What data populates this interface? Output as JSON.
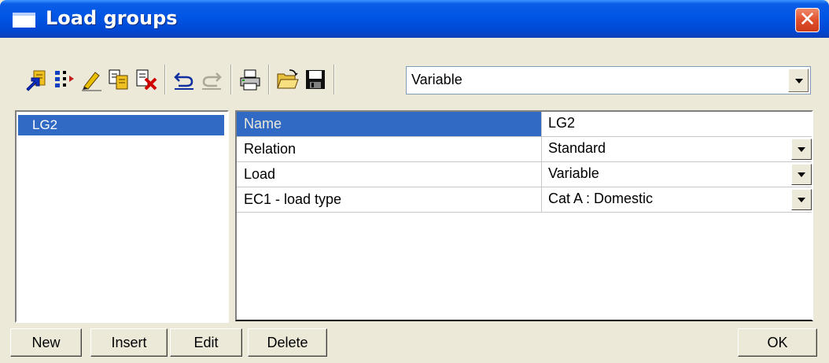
{
  "window": {
    "title": "Load groups",
    "close_label": "✕"
  },
  "toolbar": {
    "icons": [
      "add-arrow-icon",
      "insert-icon",
      "edit-pencil-icon",
      "copy-icon",
      "delete-icon",
      "undo-icon",
      "redo-icon",
      "print-icon",
      "open-folder-icon",
      "save-icon"
    ],
    "combo_value": "Variable"
  },
  "list": {
    "items": [
      "LG2"
    ]
  },
  "properties": [
    {
      "name": "Name",
      "value": "LG2",
      "dropdown": false
    },
    {
      "name": "Relation",
      "value": "Standard",
      "dropdown": true
    },
    {
      "name": "Load",
      "value": "Variable",
      "dropdown": true
    },
    {
      "name": "EC1 - load type",
      "value": "Cat A : Domestic",
      "dropdown": true
    }
  ],
  "buttons": {
    "new": "New",
    "insert": "Insert",
    "edit": "Edit",
    "delete": "Delete",
    "ok": "OK"
  },
  "colors": {
    "titlebar": "#0055e5",
    "selection": "#316ac5",
    "face": "#ece9d8",
    "close": "#e0502c"
  }
}
